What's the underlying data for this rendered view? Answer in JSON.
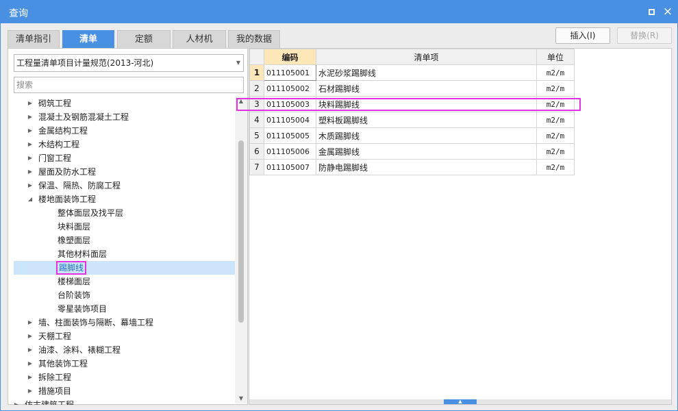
{
  "window": {
    "title": "查询",
    "maximize_label": "",
    "close_label": "×"
  },
  "tabs": [
    {
      "label": "清单指引",
      "active": false
    },
    {
      "label": "清单",
      "active": true
    },
    {
      "label": "定额",
      "active": false
    },
    {
      "label": "人材机",
      "active": false
    },
    {
      "label": "我的数据",
      "active": false
    }
  ],
  "toolbar": {
    "insert_label": "插入(I)",
    "replace_label": "替换(R)"
  },
  "spec_select": {
    "value": "工程量清单项目计量规范(2013-河北)"
  },
  "search": {
    "placeholder": "搜索",
    "value": ""
  },
  "tree": {
    "items": [
      {
        "label": "砌筑工程",
        "level": 0,
        "state": "collapsed"
      },
      {
        "label": "混凝土及钢筋混凝土工程",
        "level": 0,
        "state": "collapsed"
      },
      {
        "label": "金属结构工程",
        "level": 0,
        "state": "collapsed"
      },
      {
        "label": "木结构工程",
        "level": 0,
        "state": "collapsed"
      },
      {
        "label": "门窗工程",
        "level": 0,
        "state": "collapsed"
      },
      {
        "label": "屋面及防水工程",
        "level": 0,
        "state": "collapsed"
      },
      {
        "label": "保温、隔热、防腐工程",
        "level": 0,
        "state": "collapsed"
      },
      {
        "label": "楼地面装饰工程",
        "level": 0,
        "state": "expanded"
      },
      {
        "label": "整体面层及找平层",
        "level": 1,
        "state": "leaf"
      },
      {
        "label": "块料面层",
        "level": 1,
        "state": "leaf"
      },
      {
        "label": "橡塑面层",
        "level": 1,
        "state": "leaf"
      },
      {
        "label": "其他材料面层",
        "level": 1,
        "state": "leaf"
      },
      {
        "label": "踢脚线",
        "level": 1,
        "state": "leaf",
        "selected": true
      },
      {
        "label": "楼梯面层",
        "level": 1,
        "state": "leaf"
      },
      {
        "label": "台阶装饰",
        "level": 1,
        "state": "leaf"
      },
      {
        "label": "零星装饰项目",
        "level": 1,
        "state": "leaf"
      },
      {
        "label": "墙、柱面装饰与隔断、幕墙工程",
        "level": 0,
        "state": "collapsed"
      },
      {
        "label": "天棚工程",
        "level": 0,
        "state": "collapsed"
      },
      {
        "label": "油漆、涂料、裱糊工程",
        "level": 0,
        "state": "collapsed"
      },
      {
        "label": "其他装饰工程",
        "level": 0,
        "state": "collapsed"
      },
      {
        "label": "拆除工程",
        "level": 0,
        "state": "collapsed"
      },
      {
        "label": "措施项目",
        "level": 0,
        "state": "collapsed"
      },
      {
        "label": "仿古建筑工程",
        "level": -1,
        "state": "collapsed"
      }
    ]
  },
  "grid": {
    "headers": {
      "code": "编码",
      "item": "清单项",
      "unit": "单位"
    },
    "rows": [
      {
        "index": "1",
        "code": "011105001",
        "item": "水泥砂浆踢脚线",
        "unit": "m2/m"
      },
      {
        "index": "2",
        "code": "011105002",
        "item": "石材踢脚线",
        "unit": "m2/m"
      },
      {
        "index": "3",
        "code": "011105003",
        "item": "块料踢脚线",
        "unit": "m2/m"
      },
      {
        "index": "4",
        "code": "011105004",
        "item": "塑料板踢脚线",
        "unit": "m2/m"
      },
      {
        "index": "5",
        "code": "011105005",
        "item": "木质踢脚线",
        "unit": "m2/m"
      },
      {
        "index": "6",
        "code": "011105006",
        "item": "金属踢脚线",
        "unit": "m2/m"
      },
      {
        "index": "7",
        "code": "011105007",
        "item": "防静电踢脚线",
        "unit": "m2/m"
      }
    ]
  },
  "colors": {
    "accent": "#4a90e2",
    "highlight": "#e032e0",
    "selected_row": "#cce5fb",
    "header_active": "#fde6b8"
  }
}
